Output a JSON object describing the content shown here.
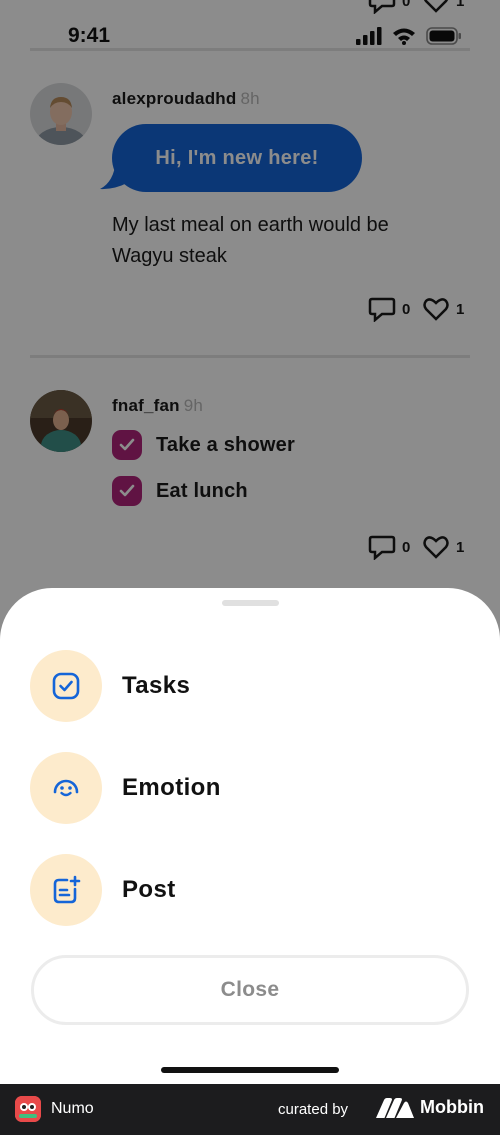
{
  "status_bar": {
    "time": "9:41"
  },
  "feed": {
    "top_partial_actions": {
      "comments": "0",
      "likes": "1"
    },
    "posts": [
      {
        "username": "alexproudadhd",
        "time_ago": "8h",
        "bubble_text": "Hi, I'm new here!",
        "text": "My last meal on earth would be Wagyu steak",
        "comments": "0",
        "likes": "1"
      },
      {
        "username": "fnaf_fan",
        "time_ago": "9h",
        "tasks": [
          "Take a shower",
          "Eat lunch"
        ],
        "comments": "0",
        "likes": "1"
      }
    ]
  },
  "sheet": {
    "options": [
      {
        "label": "Tasks",
        "icon": "task-check-icon"
      },
      {
        "label": "Emotion",
        "icon": "smile-face-icon"
      },
      {
        "label": "Post",
        "icon": "new-post-icon"
      }
    ],
    "close_label": "Close"
  },
  "footer": {
    "app_name": "Numo",
    "curated_by": "curated by",
    "brand": "Mobbin"
  },
  "colors": {
    "accent_blue": "#1565d8",
    "task_check": "#b0247a",
    "option_bg": "#fdebcc"
  }
}
